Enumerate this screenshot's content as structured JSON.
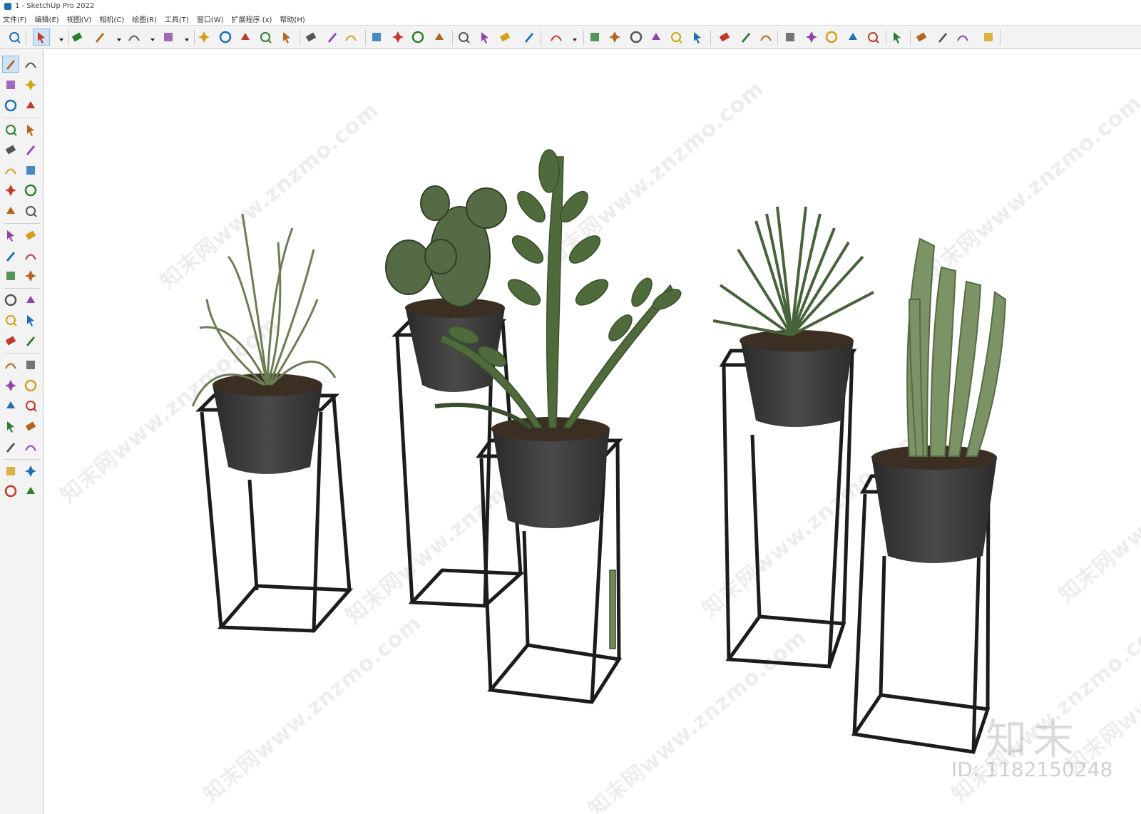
{
  "window": {
    "title": "1 - SketchUp Pro 2022"
  },
  "menu": [
    "文件(F)",
    "编辑(E)",
    "视图(V)",
    "相机(C)",
    "绘图(R)",
    "工具(T)",
    "窗口(W)",
    "扩展程序 (x)",
    "帮助(H)"
  ],
  "viewport": {
    "scene_description_hidden": true,
    "watermark_text": "知末网www.znzmo.com",
    "logo_text": "知末",
    "id_text": "ID: 1182150248"
  },
  "icons": {
    "top": [
      "zoom-extents-icon",
      "select-icon",
      "eraser-icon",
      "pencil-icon",
      "arc-icon",
      "rectangle-icon",
      "push-pull-icon",
      "follow-me-icon",
      "move-icon",
      "rotate-icon",
      "scale-icon",
      "tape-measure-icon",
      "text-icon",
      "paint-bucket-icon",
      "orbit-icon",
      "pan-icon",
      "zoom-icon",
      "zoom-window-icon",
      "warehouse-icon",
      "extension-warehouse-icon",
      "layers-icon",
      "styles-icon",
      "user-icon",
      "warehouse-model-icon",
      "section-plane-icon",
      "home-icon",
      "house-front-icon",
      "house-icon",
      "house-side-icon",
      "solid-tools-icon",
      "outer-shell-icon",
      "intersect-icon",
      "add-icon",
      "shield-icon",
      "materials-icon",
      "checker-icon",
      "cloud-upload-icon",
      "settings-icon",
      "chat-icon",
      "info-icon",
      "cart-icon",
      "account-icon"
    ],
    "left": [
      "select-icon",
      "orbit-icon",
      "paint-bucket-icon",
      "eraser-icon",
      "component-icon",
      "tape-icon",
      "pencil-icon",
      "freehand-icon",
      "rectangle-icon",
      "rotated-rectangle-icon",
      "circle-icon",
      "polygon-icon",
      "arc-icon",
      "two-point-arc-icon",
      "three-point-arc-icon",
      "pie-icon",
      "move-icon",
      "push-pull-icon",
      "rotate-icon",
      "follow-me-icon",
      "scale-icon",
      "offset-icon",
      "tape-measure-icon",
      "dimension-icon",
      "protractor-icon",
      "text-icon",
      "axes-icon",
      "3d-text-icon",
      "orbit2-icon",
      "pan-icon",
      "zoom-icon",
      "zoom-window-icon",
      "zoom-extents-icon",
      "previous-view-icon",
      "position-camera-icon",
      "look-around-icon",
      "walk-icon",
      "section-plane-icon",
      "warehouse-icon",
      "extension-icon",
      "share-component-icon",
      "extension-manager-icon"
    ]
  },
  "colors": {
    "accent": "#1f6fb5",
    "toolbar": "#f3f3f3",
    "active": "#cfe3f7",
    "pot": "#333333",
    "stand": "#1c1c1c",
    "leaf": "#4f6b3c",
    "cactus": "#6f8a5a"
  }
}
